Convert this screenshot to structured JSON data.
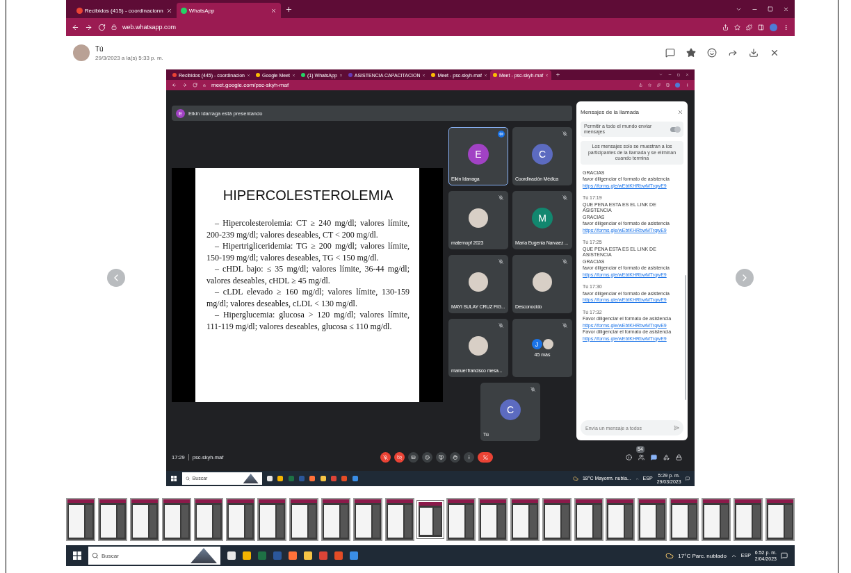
{
  "browser": {
    "tabs": [
      {
        "title": "Recibidos (415) - coordinacionn",
        "selected": false
      },
      {
        "title": "WhatsApp",
        "selected": true
      }
    ],
    "url": "web.whatsapp.com"
  },
  "viewer": {
    "sender": "Tú",
    "date": "29/3/2023 a la(s) 5:33 p. m."
  },
  "screenshot": {
    "tabs": [
      {
        "title": "Recibidos (445) - coordinacion",
        "selected": false
      },
      {
        "title": "Google Meet",
        "selected": false
      },
      {
        "title": "(1) WhatsApp",
        "selected": false
      },
      {
        "title": "ASISTENCIA CAPACITACION",
        "selected": false
      },
      {
        "title": "Meet - psc-skyh-maf",
        "selected": false
      },
      {
        "title": "Meet - psc-skyh-maf",
        "selected": true
      }
    ],
    "url": "meet.google.com/psc-skyh-maf",
    "presenter": {
      "initial": "E",
      "text": "Elkin Idarraga está presentando"
    },
    "slide": {
      "title": "HIPERCOLESTEROLEMIA",
      "paragraphs": [
        "– Hipercolesterolemia: CT ≥ 240 mg/dl; valores límite, 200-239 mg/dl; valores deseables, CT < 200 mg/dl.",
        "– Hipertrigliceridemia: TG ≥ 200 mg/dl; valores límite, 150-199 mg/dl; valores deseables, TG < 150 mg/dl.",
        "– cHDL bajo: ≤ 35 mg/dl; valores límite, 36-44 mg/dl; valores deseables, cHDL ≥ 45 mg/dl.",
        "– cLDL elevado ≥ 160 mg/dl; valores límite, 130-159 mg/dl; valores deseables, cLDL < 130 mg/dl.",
        "– Hiperglucemia: glucosa > 120 mg/dl; valores límite, 111-119 mg/dl; valores deseables, glucosa ≤ 110 mg/dl."
      ]
    },
    "participants": [
      {
        "kind": "letter",
        "name": "Elkin Idarraga",
        "initial": "E",
        "color": "#a142c4",
        "speaking": true
      },
      {
        "kind": "letter",
        "name": "Coordinación Médica",
        "initial": "C",
        "color": "#5c6bc0",
        "speaking": false
      },
      {
        "kind": "photo",
        "name": "maternopf 2023",
        "speaking": false
      },
      {
        "kind": "letter",
        "name": "María Eugenia Narvaez ...",
        "initial": "M",
        "color": "#12876f",
        "speaking": false
      },
      {
        "kind": "photo",
        "name": "MAYI SULAY CRUZ FIG...",
        "speaking": false
      },
      {
        "kind": "photo",
        "name": "Desconocido",
        "speaking": false
      },
      {
        "kind": "photo",
        "name": "manuel francisco mesa...",
        "speaking": false
      },
      {
        "kind": "more",
        "name": "45 más",
        "initial": "J",
        "color": "#1a73e8",
        "speaking": false
      },
      {
        "kind": "letter",
        "name": "Tú",
        "initial": "C",
        "color": "#5c6bc0",
        "speaking": false
      }
    ],
    "chat": {
      "title": "Mensajes de la llamada",
      "allow": {
        "label": "Permitir a todo el mundo enviar mensajes",
        "on": true
      },
      "note": "Los mensajes solo se muestran a los participantes de la llamada y se eliminan cuando termina",
      "messages": [
        {
          "lines": [
            {
              "kind": "text",
              "text": "GRACIAS"
            },
            {
              "kind": "text",
              "text": "favor diligenciar el formato de asistencia"
            },
            {
              "kind": "link",
              "text": "https://forms.gle/wEbtKHRbwMTrqwE9"
            }
          ]
        },
        {
          "sender": "Tú",
          "time": "17:19",
          "lines": [
            {
              "kind": "text",
              "text": "QUE PENA ESTA ES EL LINK DE ASISTENCIA"
            },
            {
              "kind": "text",
              "text": "GRACIAS"
            },
            {
              "kind": "text",
              "text": "favor diligenciar el formato de asistencia"
            },
            {
              "kind": "link",
              "text": "https://forms.gle/wEbtKHRbwMTrqwE9"
            }
          ]
        },
        {
          "sender": "Tú",
          "time": "17:25",
          "lines": [
            {
              "kind": "text",
              "text": "QUE PENA ESTA ES EL LINK DE ASISTENCIA"
            },
            {
              "kind": "text",
              "text": "GRACIAS"
            },
            {
              "kind": "text",
              "text": "favor diligenciar el formato de asistencia"
            },
            {
              "kind": "link",
              "text": "https://forms.gle/wEbtKHRbwMTrqwE9"
            }
          ]
        },
        {
          "sender": "Tú",
          "time": "17:30",
          "lines": [
            {
              "kind": "text",
              "text": "favor diligenciar el formato de asistencia"
            },
            {
              "kind": "link",
              "text": "https://forms.gle/wEbtKHRbwMTrqwE9"
            }
          ]
        },
        {
          "sender": "Tú",
          "time": "17:32",
          "lines": [
            {
              "kind": "text",
              "text": "Favor diligenciar el formato de asistencia"
            },
            {
              "kind": "link",
              "text": "https://forms.gle/wEbtKHRbwMTrqwE9"
            },
            {
              "kind": "text",
              "text": "Favor diligenciar el formato de asistencia"
            },
            {
              "kind": "link",
              "text": "https://forms.gle/wEbtKHRbwMTrqwE9"
            }
          ]
        }
      ],
      "input_placeholder": "Envía un mensaje a todos"
    },
    "meeting": {
      "time": "17:29",
      "code": "psc-skyh-maf"
    },
    "controls": [
      {
        "kind": "mic",
        "off": true
      },
      {
        "kind": "camera",
        "off": true
      },
      {
        "kind": "captions",
        "off": false
      },
      {
        "kind": "emoji",
        "off": false
      },
      {
        "kind": "present",
        "off": false
      },
      {
        "kind": "hand",
        "off": false
      },
      {
        "kind": "more",
        "off": false
      },
      {
        "kind": "hangup"
      }
    ],
    "people_count": "54",
    "taskbar": {
      "search": "Buscar",
      "weather": "18°C Mayorm. nubla...",
      "language": "ESP",
      "time": "5:29 p. m.",
      "date": "29/03/2023"
    }
  },
  "thumbnails": [
    {
      "selected": false
    },
    {
      "selected": false
    },
    {
      "selected": false
    },
    {
      "selected": false
    },
    {
      "selected": false
    },
    {
      "selected": false
    },
    {
      "selected": false
    },
    {
      "selected": false
    },
    {
      "selected": false
    },
    {
      "selected": false
    },
    {
      "selected": false
    },
    {
      "selected": true
    },
    {
      "selected": false
    },
    {
      "selected": false
    },
    {
      "selected": false
    },
    {
      "selected": false
    },
    {
      "selected": false
    },
    {
      "selected": false
    },
    {
      "selected": false
    },
    {
      "selected": false
    },
    {
      "selected": false
    },
    {
      "selected": false
    },
    {
      "selected": false
    }
  ],
  "taskbar": {
    "search": "Buscar",
    "weather": "17°C Parc. nublado",
    "language": "ESP",
    "time": "6:52 p. m.",
    "date": "2/04/2023"
  }
}
